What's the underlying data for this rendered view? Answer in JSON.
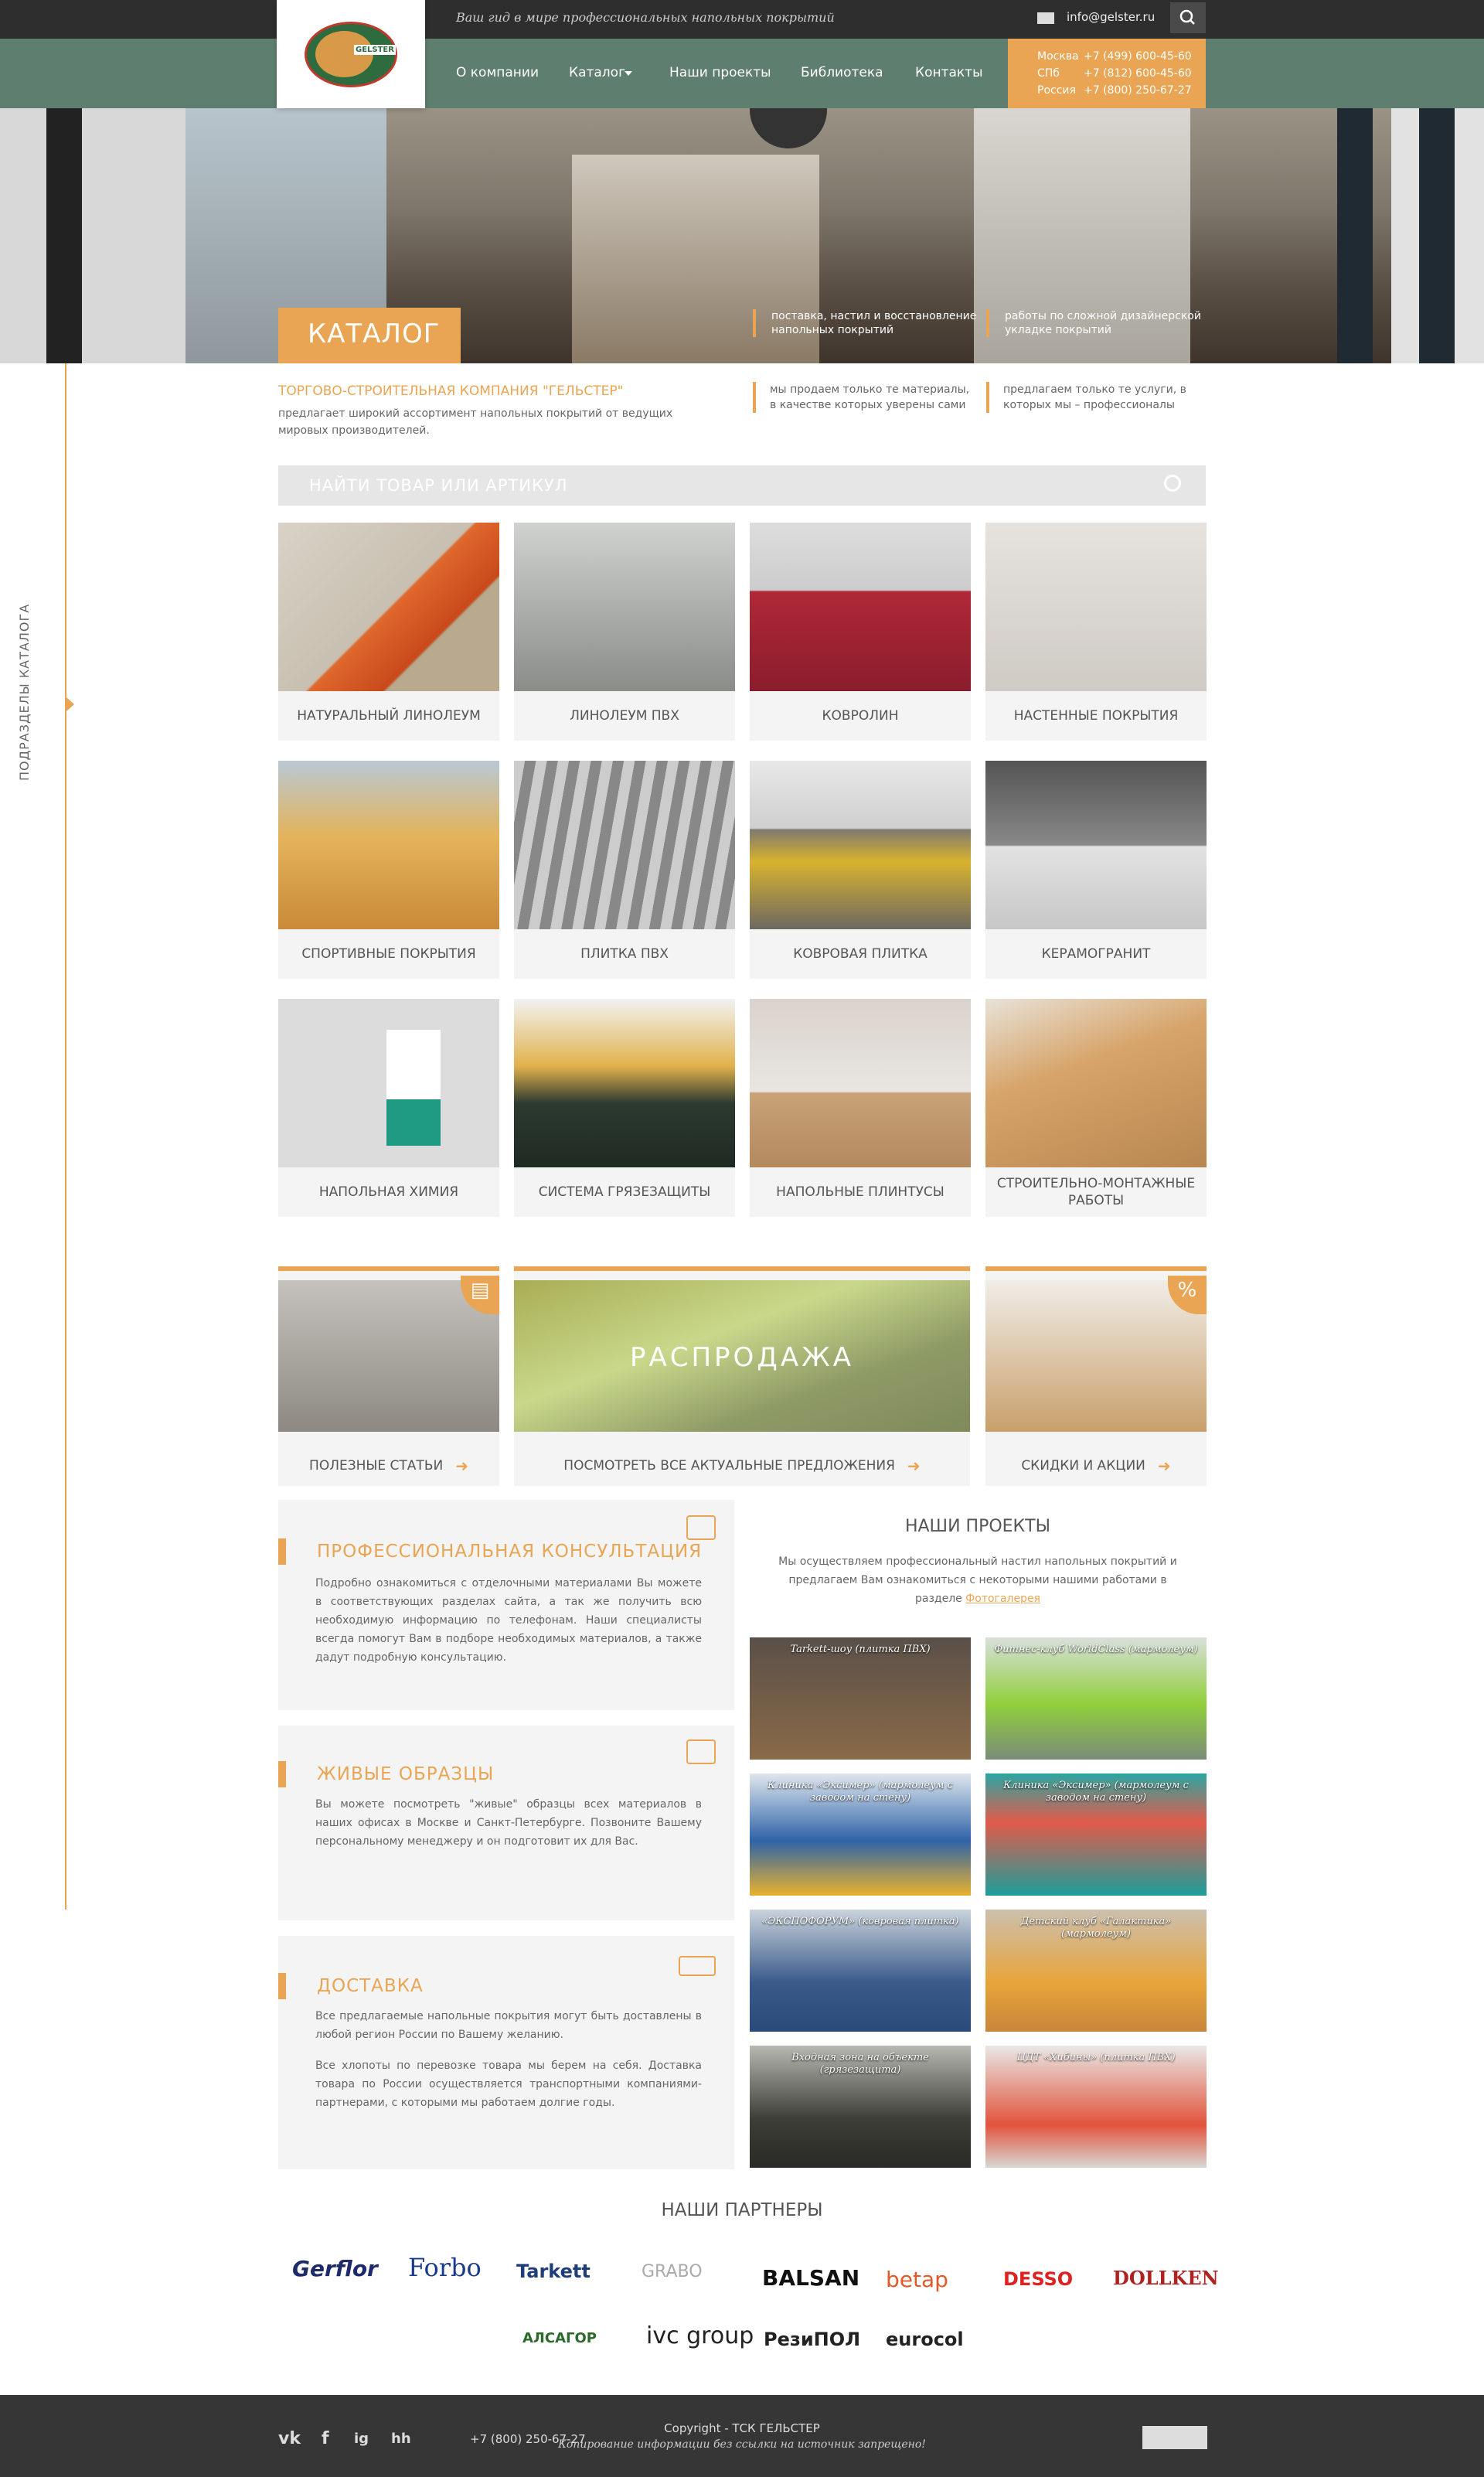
{
  "header": {
    "tagline": "Ваш гид в мире профессиональных напольных покрытий",
    "email": "info@gelster.ru",
    "logo_text": "GELSTER",
    "nav": [
      "О компании",
      "Каталог",
      "Наши проекты",
      "Библиотека",
      "Контакты"
    ],
    "phones": [
      {
        "city": "Москва",
        "number": "+7 (499) 600-45-60"
      },
      {
        "city": "СПб",
        "number": "+7 (812) 600-45-60"
      },
      {
        "city": "Россия",
        "number": "+7 (800) 250-67-27"
      }
    ]
  },
  "hero": {
    "label": "КАТАЛОГ",
    "note1": "поставка, настил и восстановление напольных покрытий",
    "note2": "работы по сложной дизайнерской укладке покрытий"
  },
  "sidebar": {
    "label": "ПОДРАЗДЕЛЫ КАТАЛОГА"
  },
  "intro": {
    "company_title": "ТОРГОВО-СТРОИТЕЛЬНАЯ КОМПАНИЯ \"ГЕЛЬСТЕР\"",
    "company_desc": "предлагает широкий ассортимент напольных покрытий от ведущих мировых производителей.",
    "feat1": "мы продаем только те материалы, в качестве которых уверены сами",
    "feat2": "предлагаем только те услуги, в которых мы – профессионалы"
  },
  "search": {
    "placeholder": "НАЙТИ ТОВАР ИЛИ АРТИКУЛ"
  },
  "catalog": [
    "НАТУРАЛЬНЫЙ ЛИНОЛЕУМ",
    "ЛИНОЛЕУМ ПВХ",
    "КОВРОЛИН",
    "НАСТЕННЫЕ ПОКРЫТИЯ",
    "СПОРТИВНЫЕ ПОКРЫТИЯ",
    "ПЛИТКА ПВХ",
    "КОВРОВАЯ ПЛИТКА",
    "КЕРАМОГРАНИТ",
    "НАПОЛЬНАЯ ХИМИЯ",
    "СИСТЕМА ГРЯЗЕЗАЩИТЫ",
    "НАПОЛЬНЫЕ ПЛИНТУСЫ",
    "СТРОИТЕЛЬНО-МОНТАЖНЫЕ РАБОТЫ"
  ],
  "promo": {
    "articles": "ПОЛЕЗНЫЕ СТАТЬИ",
    "sale_banner": "РАСПРОДАЖА",
    "sale_link": "ПОСМОТРЕТЬ ВСЕ АКТУАЛЬНЫЕ  ПРЕДЛОЖЕНИЯ",
    "discounts": "СКИДКИ И АКЦИИ",
    "percent": "%"
  },
  "boxes": [
    {
      "title": "ПРОФЕССИОНАЛЬНАЯ КОНСУЛЬТАЦИЯ",
      "text": "Подробно ознакомиться с отделочными материалами Вы можете в соответствующих разделах сайта, а так же получить всю необходимую информацию по телефонам. Наши специалисты всегда помогут Вам в подборе необходимых материалов, а также дадут подробную консультацию."
    },
    {
      "title": "ЖИВЫЕ ОБРАЗЦЫ",
      "text": "Вы можете посмотреть \"живые\" образцы всех материалов в наших офисах в Москве и Санкт-Петербурге. Позвоните Вашему персональному менеджеру и он подготовит их для Вас."
    },
    {
      "title": "ДОСТАВКА",
      "text": "Все предлагаемые напольные покрытия могут быть доставлены в любой регион России по Вашему желанию.",
      "text2": "Все хлопоты по перевозке товара мы берем на себя. Доставка товара по России осуществляется транспортными компаниями-партнерами, с которыми мы работаем долгие годы."
    }
  ],
  "projects": {
    "title": "НАШИ ПРОЕКТЫ",
    "desc": "Мы осуществляем профессиональный настил напольных покрытий и предлагаем Вам ознакомиться с некоторыми нашими работами в разделе",
    "link": "Фотогалерея",
    "items": [
      "Tarkett-шоу (плитка ПВХ)",
      "Фитнес-клуб WorldClass (мармолеум)",
      "Клиника «Эксимер» (мармолеум с заводом на стену)",
      "Клиника «Эксимер» (мармолеум с заводом на стену)",
      "«ЭКСПОФОРУМ» (ковровая плитка)",
      "Детский клуб «Галактика» (мармолеум)",
      "Входная зона на объекте (грязезащита)",
      "ЦДТ «Хибины» (плитка ПВХ)"
    ]
  },
  "partners": {
    "title": "НАШИ ПАРТНЕРЫ",
    "logos": [
      "Gerflor",
      "Forbo",
      "Tarkett",
      "GRABO",
      "BALSAN",
      "betap",
      "DESSO",
      "DOLLKEN",
      "АЛСАГОР",
      "ivc group",
      "РезиПОЛ",
      "eurocol"
    ]
  },
  "footer": {
    "social": [
      "vk",
      "f",
      "ig",
      "hh"
    ],
    "phone": "+7 (800) 250-67-27",
    "copyright": "Copyright - ТСК ГЕЛЬСТЕР",
    "notice": "Копирование информации без ссылки на источник запрещено!"
  },
  "colors": {
    "accent": "#e9a553",
    "nav": "#5e7e70",
    "dark": "#2e2e2e"
  }
}
